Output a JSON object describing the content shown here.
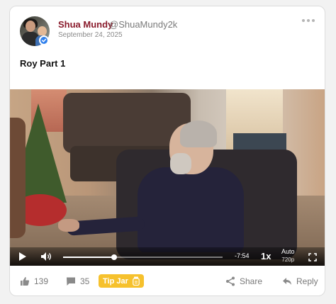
{
  "post": {
    "author_name": "Shua Mundy",
    "author_handle": "@ShuaMundy2k",
    "date": "September 24, 2025",
    "title": "Roy Part 1"
  },
  "video": {
    "time_remaining": "-7:54",
    "progress_fraction": 0.32,
    "speed": "1x",
    "quality_label": "Auto",
    "quality_value": "720p"
  },
  "footer": {
    "likes": "139",
    "comments": "35",
    "tip_jar_label": "Tip Jar",
    "share_label": "Share",
    "reply_label": "Reply"
  },
  "icons": {
    "verified": "verified-badge-icon",
    "more": "more-dots-icon",
    "play": "play-icon",
    "volume": "volume-icon",
    "fullscreen": "fullscreen-icon",
    "like": "thumbs-up-icon",
    "comment": "comment-icon",
    "tip_jar": "tip-jar-icon",
    "share": "share-icon",
    "reply": "reply-icon"
  },
  "colors": {
    "author_name": "#8a1b2c",
    "tip_jar": "#f6c12d",
    "verified": "#2f80ed"
  }
}
